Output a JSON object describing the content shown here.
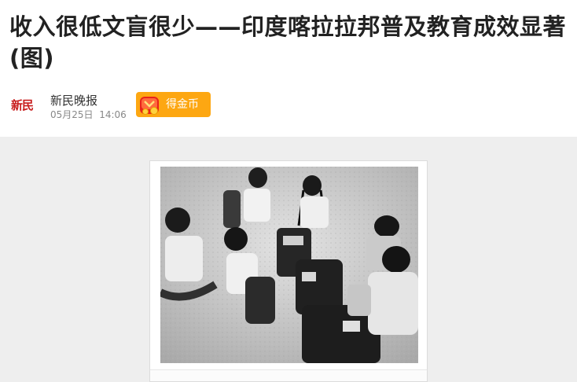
{
  "article": {
    "title": "收入很低文盲很少——印度喀拉拉邦普及教育成效显著(图)"
  },
  "meta": {
    "logo_text": "新民",
    "source": "新民晚报",
    "date": "05月25日",
    "time": "14:06",
    "coin_button_label": "得金币",
    "coin_icon": "coin-purse-icon",
    "accent_color": "#fda712"
  },
  "photo": {
    "subject": "black-and-white photo of schoolchildren sitting on sand with school bags"
  }
}
